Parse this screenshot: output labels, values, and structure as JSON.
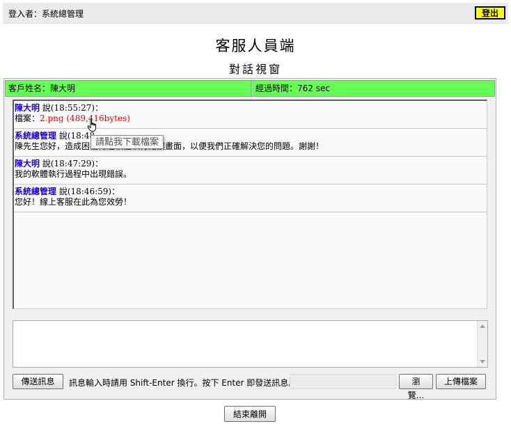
{
  "header": {
    "login_label": "登入者：系統總管理",
    "logout_label": "登出"
  },
  "page": {
    "title": "客服人員端",
    "subtitle": "對話視窗"
  },
  "info": {
    "customer_label": "客戶姓名：陳大明",
    "elapsed_label": "經過時間：762 sec"
  },
  "messages": [
    {
      "sender": "陳大明",
      "said": "說(18:55:27)：",
      "body_prefix": "檔案：",
      "file_link": "2.png (489,416bytes)"
    },
    {
      "sender": "系統總管理",
      "said": "說(18:48",
      "body": "陳先生您好，造成困擾傳送軟體執行錯誤畫面，以便我們正確解決您的問題。謝謝！"
    },
    {
      "sender": "陳大明",
      "said": "說(18:47:29)：",
      "body": "我的軟體執行過程中出現錯誤。"
    },
    {
      "sender": "系統總管理",
      "said": "說(18:46:59)：",
      "body": "您好！線上客服在此為您效勞！"
    }
  ],
  "tooltip": "請點我下載檔案",
  "input": {
    "value": ""
  },
  "controls": {
    "send_label": "傳送訊息",
    "hint": "訊息輸入時請用 Shift-Enter 換行。按下 Enter 即發送訊息。",
    "browse_label": "瀏覽...",
    "upload_label": "上傳檔案",
    "end_label": "結束離開"
  },
  "icons": {
    "cursor": "hand-pointer-icon",
    "scroll_up": "scroll-up-arrow-icon",
    "scroll_down": "scroll-down-arrow-icon"
  }
}
